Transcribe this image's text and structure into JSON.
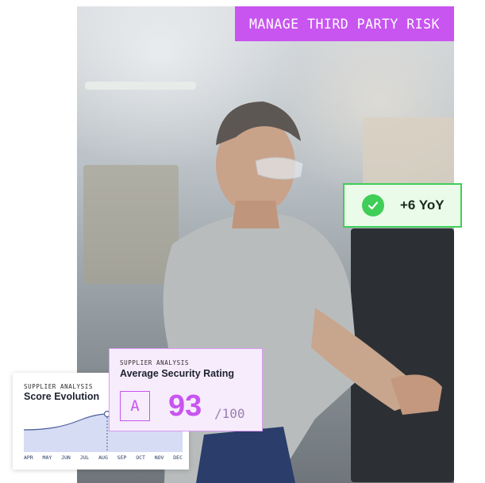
{
  "banner": {
    "text": "MANAGE THIRD PARTY RISK"
  },
  "badge": {
    "icon": "check-icon",
    "text": "+6 YoY",
    "color": "#3fce57"
  },
  "score_evolution": {
    "label": "SUPPLIER ANALYSIS",
    "title": "Score Evolution",
    "months": [
      "APR",
      "MAY",
      "JUN",
      "JUL",
      "AUG",
      "SEP",
      "OCT",
      "NOV",
      "DEC"
    ]
  },
  "security_rating": {
    "label": "SUPPLIER ANALYSIS",
    "title": "Average Security Rating",
    "grade": "A",
    "score": "93",
    "out_of": "/100",
    "accent": "#c855f0"
  }
}
